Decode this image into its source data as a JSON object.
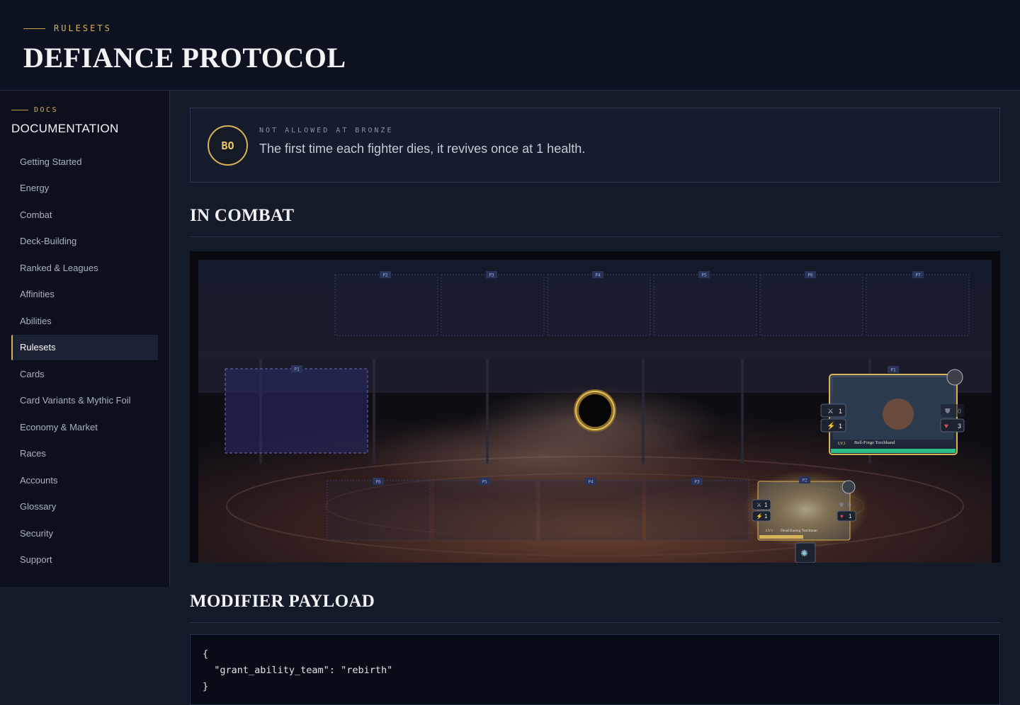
{
  "header": {
    "eyebrow": "RULESETS",
    "title": "DEFIANCE PROTOCOL"
  },
  "sidebar": {
    "eyebrow": "DOCS",
    "title": "DOCUMENTATION",
    "items": [
      {
        "label": "Getting Started"
      },
      {
        "label": "Energy"
      },
      {
        "label": "Combat"
      },
      {
        "label": "Deck-Building"
      },
      {
        "label": "Ranked & Leagues"
      },
      {
        "label": "Affinities"
      },
      {
        "label": "Abilities"
      },
      {
        "label": "Rulesets",
        "active": true
      },
      {
        "label": "Cards"
      },
      {
        "label": "Card Variants & Mythic Foil"
      },
      {
        "label": "Economy & Market"
      },
      {
        "label": "Races"
      },
      {
        "label": "Accounts"
      },
      {
        "label": "Glossary"
      },
      {
        "label": "Security"
      },
      {
        "label": "Support"
      }
    ]
  },
  "rule": {
    "badge": "BO",
    "restriction": "NOT ALLOWED AT BRONZE",
    "description": "The first time each fighter dies, it revives once at 1 health."
  },
  "sections": {
    "combat": "IN COMBAT",
    "payload": "MODIFIER PAYLOAD"
  },
  "arena": {
    "top_slots": [
      "P2",
      "P3",
      "P4",
      "P5",
      "P6",
      "P7"
    ],
    "left_slot": "P1",
    "bottom_slots": [
      "P6",
      "P5",
      "P4",
      "P3",
      "P2"
    ],
    "enemy_card": {
      "slot": "P1",
      "level": "LV.1",
      "name": "Bell-Forge Torchhand",
      "attack": "1",
      "speed": "1",
      "armor": "0",
      "health": "3"
    },
    "player_card": {
      "slot": "P2",
      "level": "LV.1",
      "name": "Dead-Easing Torchman",
      "attack": "1",
      "speed": "1",
      "armor": "0",
      "health": "1"
    }
  },
  "code": {
    "lines": [
      "{",
      "  \"grant_ability_team\": \"rebirth\"",
      "}"
    ]
  },
  "colors": {
    "accent": "#d8b256",
    "background": "#131a28",
    "topbar": "#0c1220",
    "sidebar": "#0b101c"
  }
}
